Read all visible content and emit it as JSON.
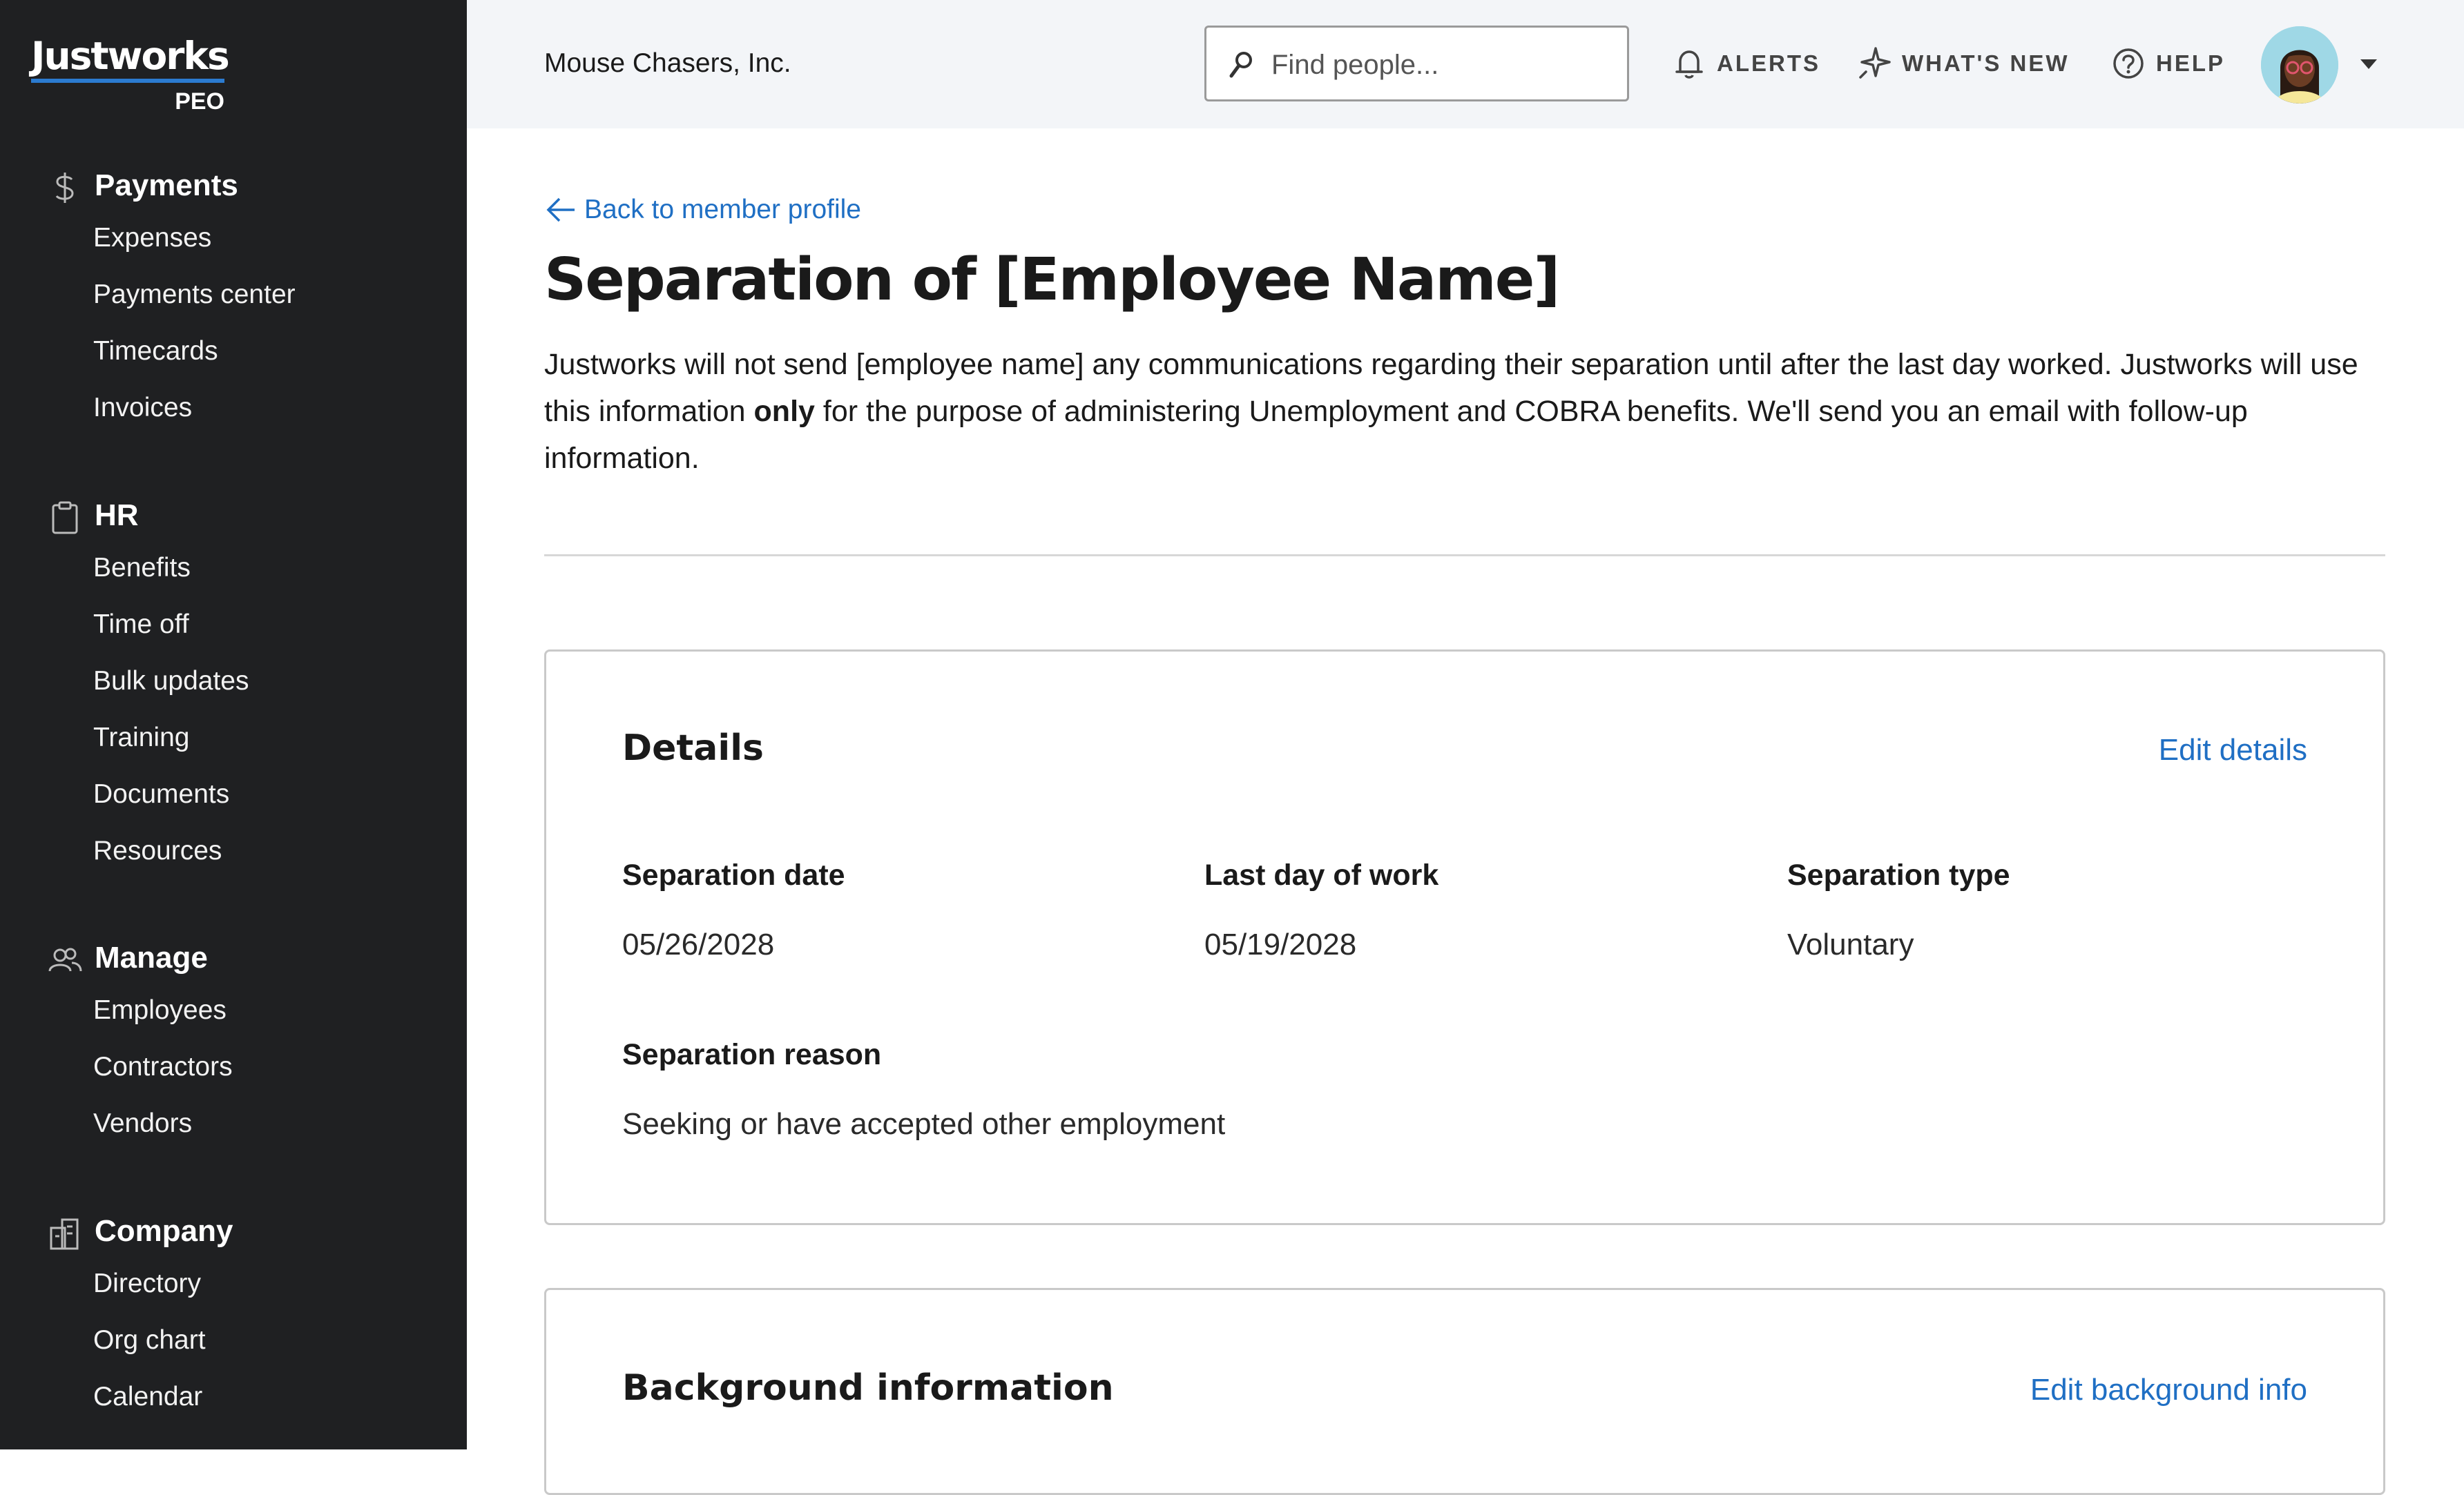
{
  "brand": {
    "name": "Justworks",
    "sub": "PEO",
    "accent": "#2b7bd0"
  },
  "colors": {
    "sidebar_bg": "#1f2022",
    "topbar_bg": "#f3f5f8",
    "link": "#1f6fc4",
    "card_border": "#c9c9c9"
  },
  "sidebar": {
    "sections": [
      {
        "icon": "dollar-icon",
        "label": "Payments",
        "items": [
          "Expenses",
          "Payments center",
          "Timecards",
          "Invoices"
        ]
      },
      {
        "icon": "clipboard-icon",
        "label": "HR",
        "items": [
          "Benefits",
          "Time off",
          "Bulk updates",
          "Training",
          "Documents",
          "Resources"
        ]
      },
      {
        "icon": "people-icon",
        "label": "Manage",
        "items": [
          "Employees",
          "Contractors",
          "Vendors"
        ]
      },
      {
        "icon": "building-icon",
        "label": "Company",
        "items": [
          "Directory",
          "Org chart",
          "Calendar"
        ]
      }
    ]
  },
  "topbar": {
    "company": "Mouse Chasers, Inc.",
    "search_placeholder": "Find people...",
    "alerts": "ALERTS",
    "whats_new": "WHAT'S NEW",
    "help": "HELP"
  },
  "main": {
    "back_link": "Back to member profile",
    "title": "Separation of [Employee Name]",
    "intro_before": "Justworks will not send [employee name] any communications regarding their separation until after the last day worked. Justworks will use this information ",
    "intro_bold": "only",
    "intro_after": " for the purpose of administering Unemployment and COBRA benefits. We'll send you an email with follow-up information."
  },
  "details": {
    "title": "Details",
    "edit": "Edit details",
    "separation_date_label": "Separation date",
    "separation_date": "05/26/2028",
    "last_day_label": "Last day of work",
    "last_day": "05/19/2028",
    "type_label": "Separation type",
    "type": "Voluntary",
    "reason_label": "Separation reason",
    "reason": "Seeking or have accepted other employment"
  },
  "background": {
    "title": "Background information",
    "edit": "Edit background info"
  }
}
